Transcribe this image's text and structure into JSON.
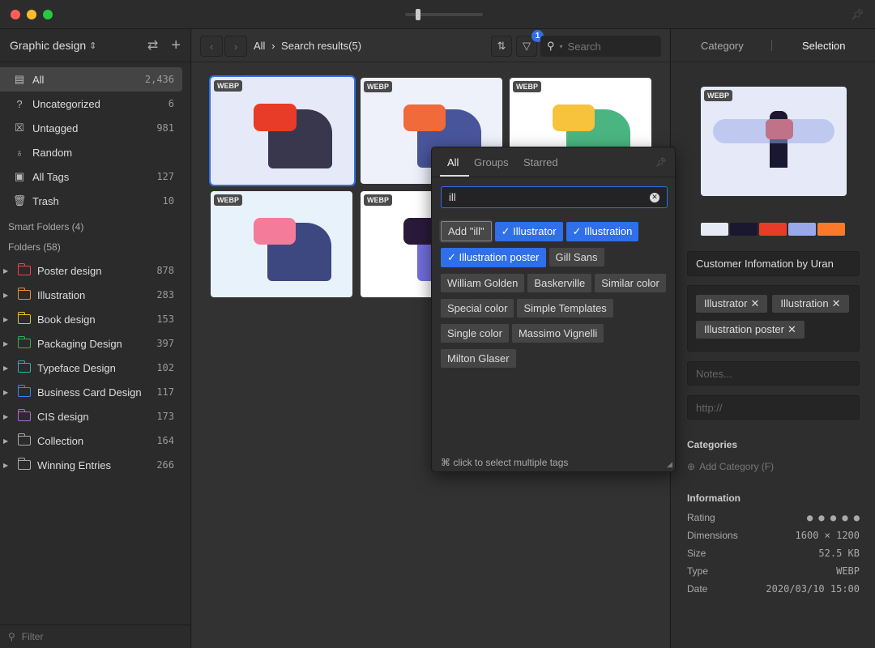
{
  "window": {
    "badge_count": "1"
  },
  "sidebar": {
    "library": "Graphic design",
    "items": [
      {
        "label": "All",
        "count": "2,436",
        "icon": "archive-icon"
      },
      {
        "label": "Uncategorized",
        "count": "6",
        "icon": "question-folder-icon"
      },
      {
        "label": "Untagged",
        "count": "981",
        "icon": "untagged-icon"
      },
      {
        "label": "Random",
        "count": "",
        "icon": "lightbulb-icon"
      },
      {
        "label": "All Tags",
        "count": "127",
        "icon": "tag-icon"
      },
      {
        "label": "Trash",
        "count": "10",
        "icon": "trash-icon"
      }
    ],
    "smart_folders": "Smart Folders (4)",
    "folders_label": "Folders (58)",
    "folders": [
      {
        "label": "Poster design",
        "count": "878",
        "color": "#e5484d"
      },
      {
        "label": "Illustration",
        "count": "283",
        "color": "#f08c2e"
      },
      {
        "label": "Book design",
        "count": "153",
        "color": "#e8c22a"
      },
      {
        "label": "Packaging Design",
        "count": "397",
        "color": "#2fb550"
      },
      {
        "label": "Typeface Design",
        "count": "102",
        "color": "#22b8b0"
      },
      {
        "label": "Business Card Design",
        "count": "117",
        "color": "#3b82f6"
      },
      {
        "label": "CIS design",
        "count": "173",
        "color": "#b065e0"
      },
      {
        "label": "Collection",
        "count": "164",
        "color": "#aaaaaa"
      },
      {
        "label": "Winning Entries",
        "count": "266",
        "color": "#aaaaaa"
      }
    ],
    "filter_placeholder": "Filter"
  },
  "toolbar": {
    "crumb_root": "All",
    "crumb_current": "Search results(5)",
    "search_placeholder": "Search",
    "filter_badge": "1"
  },
  "grid": {
    "items": [
      {
        "type": "WEBP"
      },
      {
        "type": "WEBP"
      },
      {
        "type": "WEBP"
      },
      {
        "type": "WEBP"
      },
      {
        "type": "WEBP"
      }
    ]
  },
  "popup": {
    "tabs": [
      "All",
      "Groups",
      "Starred"
    ],
    "query": "ill",
    "add_label": "Add \"ill\"",
    "tags": [
      {
        "label": "Illustrator",
        "on": true
      },
      {
        "label": "Illustration",
        "on": true
      },
      {
        "label": "Illustration poster",
        "on": true
      },
      {
        "label": "Gill Sans",
        "on": false
      },
      {
        "label": "William Golden",
        "on": false
      },
      {
        "label": "Baskerville",
        "on": false
      },
      {
        "label": "Similar color",
        "on": false
      },
      {
        "label": "Special color",
        "on": false
      },
      {
        "label": "Simple Templates",
        "on": false
      },
      {
        "label": "Single color",
        "on": false
      },
      {
        "label": "Massimo Vignelli",
        "on": false
      },
      {
        "label": "Milton Glaser",
        "on": false
      }
    ],
    "hint": "⌘ click to select multiple tags"
  },
  "inspector": {
    "tabs": [
      "Category",
      "Selection"
    ],
    "type_badge": "WEBP",
    "palette": [
      "#e6eaf5",
      "#1a1830",
      "#e83c28",
      "#98a8e8",
      "#fb7a2a"
    ],
    "name": "Customer Infomation by Uran",
    "tags": [
      "Illustrator",
      "Illustration",
      "Illustration poster"
    ],
    "notes_placeholder": "Notes...",
    "url_placeholder": "http://",
    "categories_title": "Categories",
    "add_category": "Add Category (F)",
    "info_title": "Information",
    "info": [
      {
        "k": "Rating",
        "v": "● ● ● ● ●"
      },
      {
        "k": "Dimensions",
        "v": "1600 × 1200"
      },
      {
        "k": "Size",
        "v": "52.5 KB"
      },
      {
        "k": "Type",
        "v": "WEBP"
      },
      {
        "k": "Date",
        "v": "2020/03/10 15:00"
      }
    ]
  }
}
